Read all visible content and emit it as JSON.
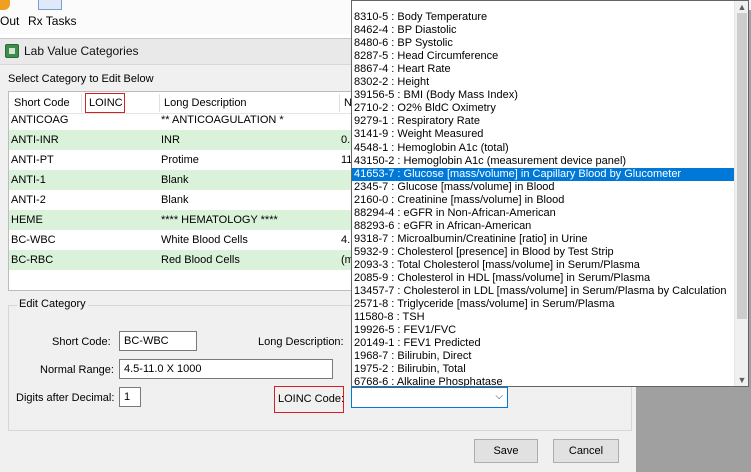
{
  "toolbar": {
    "out_label": "Out",
    "rx_label": "Rx Tasks"
  },
  "window": {
    "title": "Lab Value Categories",
    "select_label": "Select Category to Edit Below"
  },
  "grid": {
    "columns": [
      "Short Code",
      "LOINC",
      "Long Description",
      "N"
    ],
    "rows": [
      {
        "code": "ANTICOAG",
        "loinc": "",
        "desc": "** ANTICOAGULATION *",
        "n": ""
      },
      {
        "code": "ANTI-INR",
        "loinc": "",
        "desc": "INR",
        "n": "0."
      },
      {
        "code": "ANTI-PT",
        "loinc": "",
        "desc": "Protime",
        "n": "11"
      },
      {
        "code": "ANTI-1",
        "loinc": "",
        "desc": "Blank",
        "n": ""
      },
      {
        "code": "ANTI-2",
        "loinc": "",
        "desc": "Blank",
        "n": ""
      },
      {
        "code": "HEME",
        "loinc": "",
        "desc": "**** HEMATOLOGY ****",
        "n": ""
      },
      {
        "code": "BC-WBC",
        "loinc": "",
        "desc": "White Blood Cells",
        "n": "4."
      },
      {
        "code": "BC-RBC",
        "loinc": "",
        "desc": "Red Blood Cells",
        "n": "(m"
      }
    ]
  },
  "edit": {
    "legend": "Edit Category",
    "short_code_label": "Short Code:",
    "short_code_value": "BC-WBC",
    "long_desc_label": "Long Description:",
    "normal_range_label": "Normal Range:",
    "normal_range_value": "4.5-11.0 X 1000",
    "digits_label": "Digits after Decimal:",
    "digits_value": "1",
    "loinc_label": "LOINC Code:",
    "loinc_value": ""
  },
  "buttons": {
    "save": "Save",
    "cancel": "Cancel"
  },
  "dropdown": {
    "selected_index": 12,
    "items": [
      "8310-5 : Body Temperature",
      "8462-4 : BP Diastolic",
      "8480-6 : BP Systolic",
      "8287-5 : Head Circumference",
      "8867-4 : Heart Rate",
      "8302-2 : Height",
      "39156-5 : BMI (Body Mass Index)",
      "2710-2 : O2% BldC Oximetry",
      "9279-1 : Respiratory Rate",
      "3141-9 : Weight Measured",
      "4548-1 : Hemoglobin A1c (total)",
      "43150-2 : Hemoglobin A1c (measurement device panel)",
      "41653-7 : Glucose [mass/volume] in Capillary Blood by Glucometer",
      "2345-7 : Glucose [mass/volume] in Blood",
      "2160-0 : Creatinine [mass/volume] in Blood",
      "88294-4 : eGFR in Non-African-American",
      "88293-6 : eGFR in African-American",
      "9318-7 : Microalbumin/Creatinine [ratio] in Urine",
      "5932-9 : Cholesterol [presence] in Blood by Test Strip",
      "2093-3 : Total Cholesterol [mass/volume] in Serum/Plasma",
      "2085-9 : Cholesterol in HDL [mass/volume] in Serum/Plasma",
      "13457-7 : Cholesterol in LDL [mass/volume] in Serum/Plasma by Calculation",
      "2571-8 : Triglyceride [mass/volume] in Serum/Plasma",
      "11580-8 : TSH",
      "19926-5 : FEV1/FVC",
      "20149-1 : FEV1 Predicted",
      "1968-7 : Bilirubin, Direct",
      "1975-2 : Bilirubin, Total",
      "6768-6 : Alkaline Phosphatase"
    ]
  },
  "colors": {
    "selected_bg": "#0078d7",
    "alt_row_bg": "#d9f2d9",
    "highlight_box": "#d42020"
  },
  "icons": [
    "out-icon",
    "rx-tasks-icon",
    "window-app-icon",
    "chevron-down-icon",
    "scroll-up-icon",
    "scroll-down-icon"
  ]
}
